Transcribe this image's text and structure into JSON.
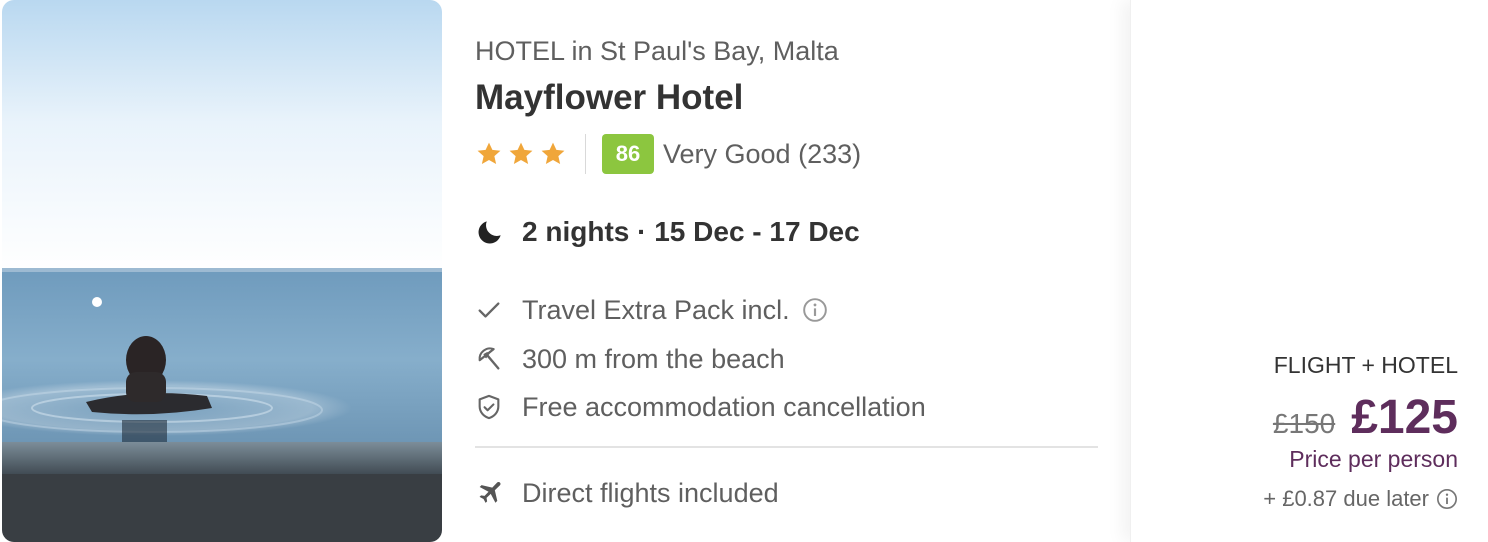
{
  "hotel": {
    "location": "HOTEL in St Paul's Bay, Malta",
    "name": "Mayflower Hotel",
    "star_count": 3,
    "score": "86",
    "score_label": "Very Good (233)",
    "score_color": "#8cc63f",
    "star_color": "#f0a63a"
  },
  "stay": {
    "icon": "moon-icon",
    "text": "2 nights · 15 Dec - 17 Dec"
  },
  "features": [
    {
      "icon": "check-icon",
      "text": "Travel Extra Pack incl.",
      "has_info": true
    },
    {
      "icon": "beach-umbrella-icon",
      "text": "300 m from the beach",
      "has_info": false
    },
    {
      "icon": "shield-check-icon",
      "text": "Free accommodation cancellation",
      "has_info": false
    }
  ],
  "flights": {
    "icon": "airplane-icon",
    "text": "Direct flights included"
  },
  "price": {
    "package_label": "FLIGHT + HOTEL",
    "old_price": "£150",
    "new_price": "£125",
    "per_person_label": "Price per person",
    "due_later": "+ £0.87 due later",
    "accent_color": "#5e2d5c"
  },
  "photo": {
    "subject": "person-in-infinity-pool-overlooking-sea"
  }
}
